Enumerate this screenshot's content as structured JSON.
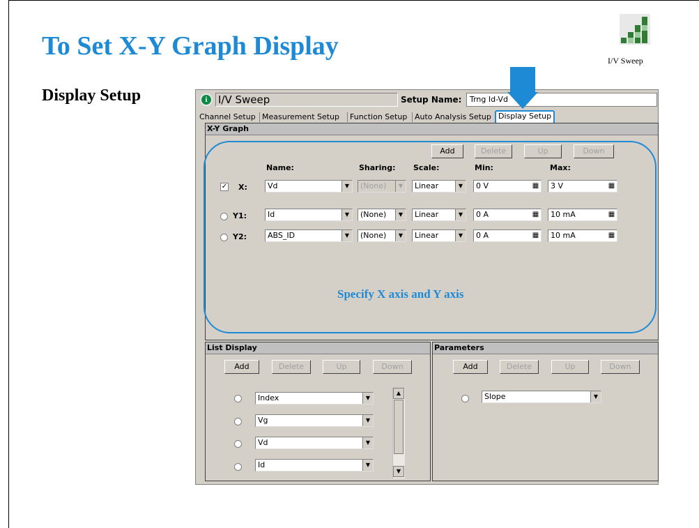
{
  "slide": {
    "title": "To Set X-Y Graph Display",
    "subtitle": "Display Setup",
    "app_icon_label": "I/V Sweep",
    "annotation": "Specify X axis and Y axis",
    "colors": {
      "accent": "#1e8ad6"
    }
  },
  "window": {
    "mode_title": "I/V Sweep",
    "setup_name_label": "Setup Name:",
    "setup_name_value": "Trng Id-Vd",
    "tabs": [
      {
        "label": "Channel Setup"
      },
      {
        "label": "Measurement Setup"
      },
      {
        "label": "Function Setup"
      },
      {
        "label": "Auto Analysis Setup"
      },
      {
        "label": "Display Setup",
        "active": true
      }
    ]
  },
  "xy_graph": {
    "header": "X-Y Graph",
    "buttons": {
      "add": "Add",
      "delete": "Delete",
      "up": "Up",
      "down": "Down"
    },
    "columns": {
      "name": "Name:",
      "sharing": "Sharing:",
      "scale": "Scale:",
      "min": "Min:",
      "max": "Max:"
    },
    "rows": [
      {
        "label": "X:",
        "name": "Vd",
        "sharing": "(None)",
        "scale": "Linear",
        "min": "0 V",
        "max": "3 V",
        "checked": true
      },
      {
        "label": "Y1:",
        "name": "Id",
        "sharing": "(None)",
        "scale": "Linear",
        "min": "0 A",
        "max": "10 mA"
      },
      {
        "label": "Y2:",
        "name": "ABS_ID",
        "sharing": "(None)",
        "scale": "Linear",
        "min": "0 A",
        "max": "10 mA"
      }
    ]
  },
  "list_display": {
    "header": "List Display",
    "buttons": {
      "add": "Add",
      "delete": "Delete",
      "up": "Up",
      "down": "Down"
    },
    "items": [
      "Index",
      "Vg",
      "Vd",
      "Id"
    ]
  },
  "parameters": {
    "header": "Parameters",
    "buttons": {
      "add": "Add",
      "delete": "Delete",
      "up": "Up",
      "down": "Down"
    },
    "items": [
      "Slope"
    ]
  },
  "icons": [
    "info-icon",
    "iv-sweep-icon",
    "arrow-down-icon",
    "dropdown-arrow-icon",
    "calculator-icon",
    "scroll-up-icon",
    "scroll-down-icon"
  ]
}
